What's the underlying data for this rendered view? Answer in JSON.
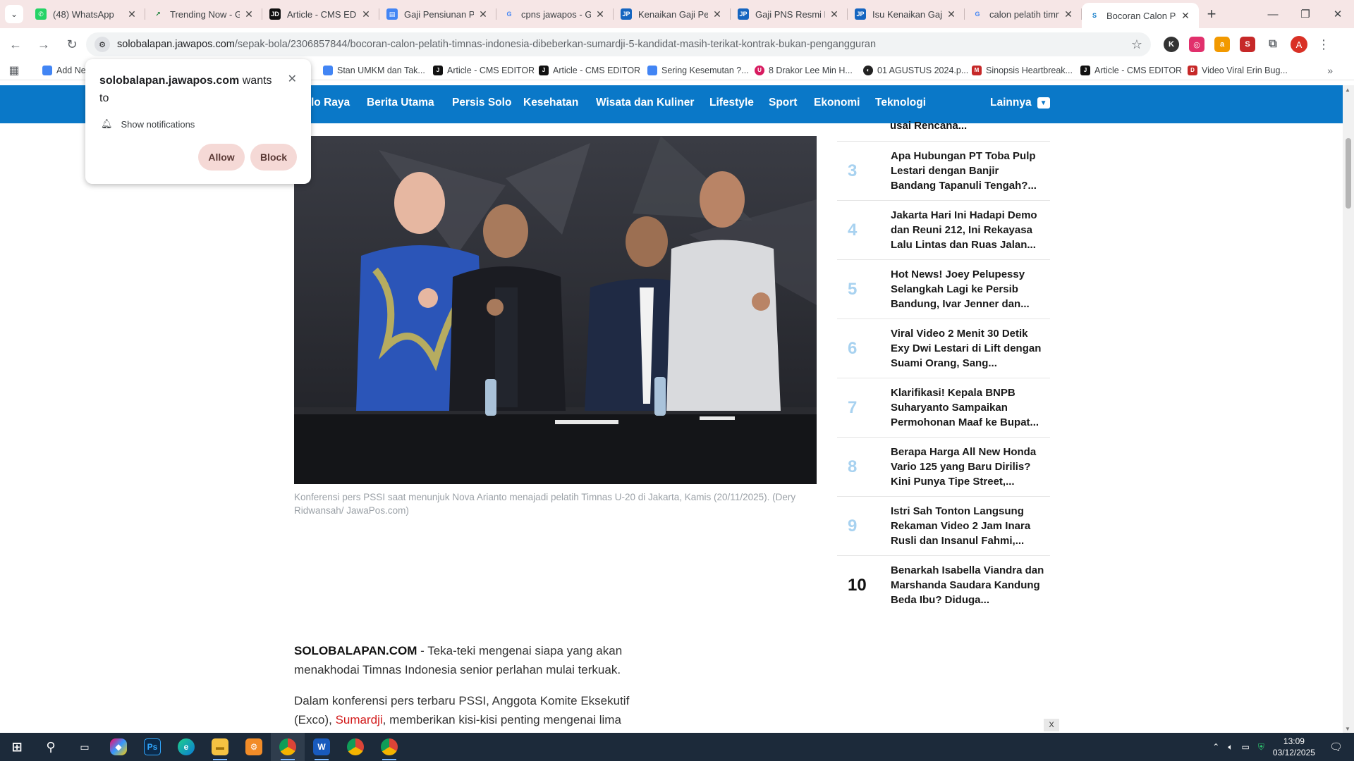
{
  "browser": {
    "tabs": [
      {
        "title": "(48) WhatsApp",
        "fav_color": "#25d366",
        "fav_text": "✆"
      },
      {
        "title": "Trending Now - G",
        "fav_color": "#ffffff",
        "fav_text": "↗"
      },
      {
        "title": "Article - CMS EDIT",
        "fav_color": "#111111",
        "fav_text": "JD"
      },
      {
        "title": "Gaji Pensiunan PN",
        "fav_color": "#4285f4",
        "fav_text": "▤"
      },
      {
        "title": "cpns jawapos - Go",
        "fav_color": "#ffffff",
        "fav_text": "G"
      },
      {
        "title": "Kenaikan Gaji Pen",
        "fav_color": "#1565c0",
        "fav_text": "JP"
      },
      {
        "title": "Gaji PNS Resmi Di",
        "fav_color": "#1565c0",
        "fav_text": "JP"
      },
      {
        "title": "Isu Kenaikan Gaji",
        "fav_color": "#1565c0",
        "fav_text": "JP"
      },
      {
        "title": "calon pelatih timn",
        "fav_color": "#ffffff",
        "fav_text": "G"
      },
      {
        "title": "Bocoran Calon Pe",
        "fav_color": "#ffffff",
        "fav_text": "S"
      }
    ],
    "url_domain": "solobalapan.jawapos.com",
    "url_path": "/sepak-bola/2306857844/bocoran-calon-pelatih-timnas-indonesia-dibeberkan-sumardji-5-kandidat-masih-terikat-kontrak-bukan-pengangguran",
    "profile_initial": "A",
    "bookmarks": [
      {
        "label": "Add Ne",
        "color": "#4285f4"
      },
      {
        "label": "Stan UMKM dan Tak...",
        "color": "#4285f4"
      },
      {
        "label": "Article - CMS EDITOR",
        "color": "#111111"
      },
      {
        "label": "Article - CMS EDITOR",
        "color": "#111111"
      },
      {
        "label": "Sering Kesemutan ?...",
        "color": "#4285f4"
      },
      {
        "label": "8 Drakor Lee Min H...",
        "color": "#d81b60"
      },
      {
        "label": "01 AGUSTUS 2024.p...",
        "color": "#222222"
      },
      {
        "label": "Sinopsis Heartbreak...",
        "color": "#c62828"
      },
      {
        "label": "Article - CMS EDITOR",
        "color": "#111111"
      },
      {
        "label": "Video Viral Erin Bug...",
        "color": "#c62828"
      }
    ]
  },
  "permission": {
    "site": "solobalapan.jawapos.com",
    "suffix": "wants to",
    "item": "Show notifications",
    "allow": "Allow",
    "block": "Block"
  },
  "site_nav": {
    "items": [
      "lo Raya",
      "Berita Utama",
      "Persis Solo",
      "Kesehatan",
      "Wisata dan Kuliner",
      "Lifestyle",
      "Sport",
      "Ekonomi",
      "Teknologi"
    ],
    "more": "Lainnya"
  },
  "article": {
    "caption": "Konferensi pers PSSI saat menunjuk Nova Arianto menajadi pelatih Timnas U-20 di Jakarta, Kamis (20/11/2025). (Dery Ridwansah/ JawaPos.com)",
    "lead_brand": "SOLOBALAPAN.COM",
    "lead_text": " - Teka-teki mengenai siapa yang akan menakhodai Timnas Indonesia senior perlahan mulai terkuak.",
    "para_start": "Dalam konferensi pers terbaru PSSI, Anggota Komite Eksekutif (Exco), ",
    "para_link": "Sumardji",
    "para_end": ", memberikan kisi-kisi penting mengenai lima"
  },
  "popular": {
    "prev_tail": "usai Rencana...",
    "items": [
      {
        "num": "3",
        "title": "Apa Hubungan PT Toba Pulp Lestari dengan Banjir Bandang Tapanuli Tengah?..."
      },
      {
        "num": "4",
        "title": "Jakarta Hari Ini Hadapi Demo dan Reuni 212, Ini Rekayasa Lalu Lintas dan Ruas Jalan..."
      },
      {
        "num": "5",
        "title": "Hot News! Joey Pelupessy Selangkah Lagi ke Persib Bandung, Ivar Jenner dan..."
      },
      {
        "num": "6",
        "title": "Viral Video 2 Menit 30 Detik Exy Dwi Lestari di Lift dengan Suami Orang, Sang..."
      },
      {
        "num": "7",
        "title": "Klarifikasi! Kepala BNPB Suharyanto Sampaikan Permohonan Maaf ke Bupat..."
      },
      {
        "num": "8",
        "title": "Berapa Harga All New Honda Vario 125 yang Baru Dirilis? Kini Punya Tipe Street,..."
      },
      {
        "num": "9",
        "title": "Istri Sah Tonton Langsung Rekaman Video 2 Jam Inara Rusli dan Insanul Fahmi,..."
      },
      {
        "num": "10",
        "title": "Benarkah Isabella Viandra dan Marshanda Saudara Kandung Beda Ibu? Diduga..."
      }
    ]
  },
  "ad_close": "X",
  "taskbar": {
    "time": "13:09",
    "date": "03/12/2025"
  },
  "colors": {
    "nav_blue": "#0a78c8",
    "link_red": "#d21a1a",
    "popular_num": "#a8d2f0",
    "permission_button": "#f5d9d6"
  }
}
